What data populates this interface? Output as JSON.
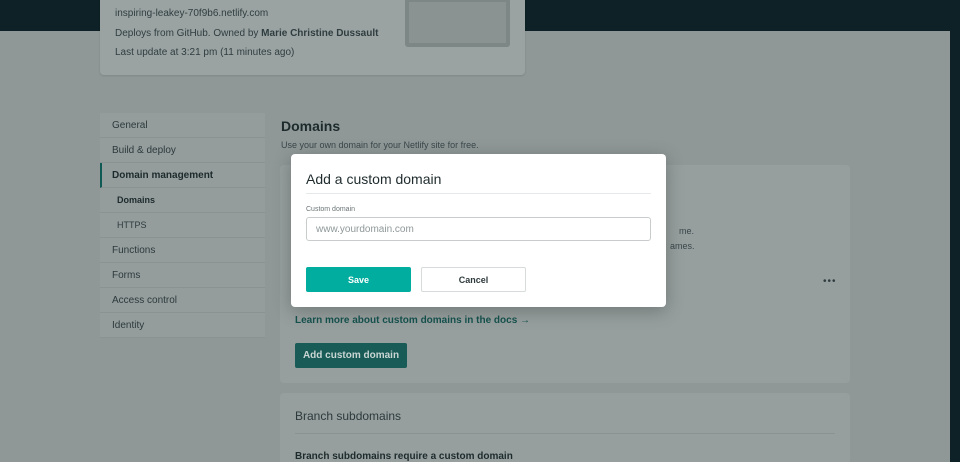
{
  "site": {
    "url": "inspiring-leakey-70f9b6.netlify.com",
    "deploys_prefix": "Deploys from GitHub. Owned by ",
    "owner": "Marie Christine Dussault",
    "last_update": "Last update at 3:21 pm (11 minutes ago)"
  },
  "sidebar": {
    "items": [
      {
        "label": "General"
      },
      {
        "label": "Build & deploy"
      },
      {
        "label": "Domain management"
      },
      {
        "label": "Domains"
      },
      {
        "label": "HTTPS"
      },
      {
        "label": "Functions"
      },
      {
        "label": "Forms"
      },
      {
        "label": "Access control"
      },
      {
        "label": "Identity"
      }
    ]
  },
  "main": {
    "title": "Domains",
    "subtitle": "Use your own domain for your Netlify site for free.",
    "custom_domains_panel": {
      "fragment_1": "me.",
      "fragment_2": "ames.",
      "more_icon": "ellipsis-icon",
      "docs_link": "Learn more about custom domains in the docs →",
      "add_button": "Add custom domain"
    },
    "branch_panel": {
      "title": "Branch subdomains",
      "note": "Branch subdomains require a custom domain"
    }
  },
  "modal": {
    "title": "Add a custom domain",
    "field_label": "Custom domain",
    "placeholder": "www.yourdomain.com",
    "value": "",
    "save_label": "Save",
    "cancel_label": "Cancel"
  },
  "colors": {
    "accent": "#00ad9f",
    "overlay_dark": "#0d2126",
    "link": "#16534f"
  }
}
